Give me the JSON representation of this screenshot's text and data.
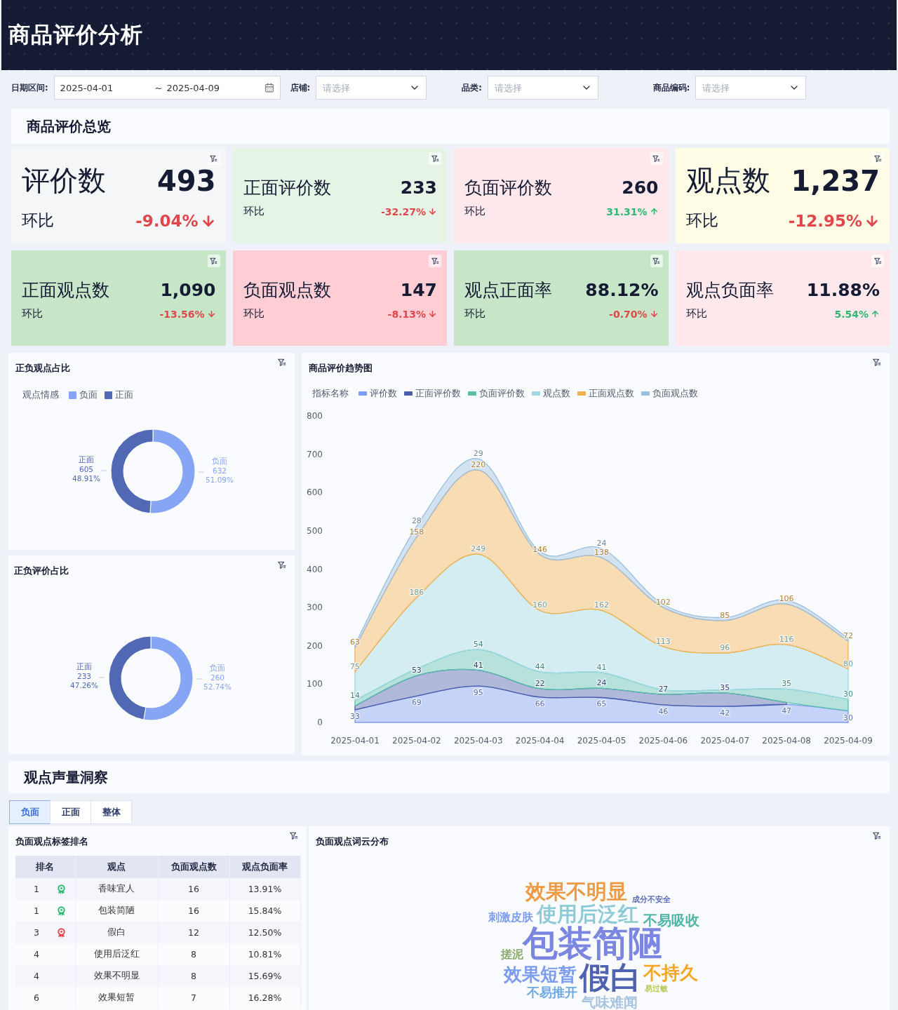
{
  "header": {
    "title": "商品评价分析"
  },
  "filters": {
    "date": {
      "label": "日期区间:",
      "start": "2025-04-01",
      "separator": "~",
      "end": "2025-04-09"
    },
    "selects": [
      {
        "label": "店铺:",
        "placeholder": "请选择"
      },
      {
        "label": "品类:",
        "placeholder": "请选择"
      },
      {
        "label": "商品编码:",
        "placeholder": "请选择"
      }
    ]
  },
  "overview": {
    "title": "商品评价总览",
    "kpis": [
      {
        "label": "评价数",
        "value": "493",
        "compare_label": "环比",
        "change": "-9.04%",
        "rising": false,
        "color": "#f5f6f7",
        "kind": "large"
      },
      {
        "label": "正面评价数",
        "value": "233",
        "compare_label": "环比",
        "change": "-32.27%",
        "rising": false,
        "color": "#e6f4e6",
        "kind": "normal"
      },
      {
        "label": "负面评价数",
        "value": "260",
        "compare_label": "环比",
        "change": "31.31%",
        "rising": true,
        "color": "#ffe8ec",
        "kind": "normal"
      },
      {
        "label": "观点数",
        "value": "1,237",
        "compare_label": "环比",
        "change": "-12.95%",
        "rising": false,
        "color": "#fffde6",
        "kind": "large"
      },
      {
        "label": "正面观点数",
        "value": "1,090",
        "compare_label": "环比",
        "change": "-13.56%",
        "rising": false,
        "color": "#c6e6c7",
        "kind": "normal"
      },
      {
        "label": "负面观点数",
        "value": "147",
        "compare_label": "环比",
        "change": "-8.13%",
        "rising": false,
        "color": "#ffcdd4",
        "kind": "normal"
      },
      {
        "label": "观点正面率",
        "value": "88.12%",
        "compare_label": "环比",
        "change": "-0.70%",
        "rising": false,
        "color": "#c6e6c7",
        "kind": "normal"
      },
      {
        "label": "观点负面率",
        "value": "11.88%",
        "compare_label": "环比",
        "change": "5.54%",
        "rising": true,
        "color": "#ffe8ec",
        "kind": "normal"
      }
    ]
  },
  "opinion_share": {
    "chart_data": {
      "type": "donut",
      "title": "正负观点占比",
      "legend_title": "观点情感",
      "categories": [
        "负面",
        "正面"
      ],
      "colors": [
        "#86a6f5",
        "#5168b4"
      ],
      "values": [
        51.09,
        48.91
      ],
      "value_labels": [
        "51.09%",
        "48.91%"
      ],
      "annotations": [
        {
          "text": "632"
        },
        {
          "text": "605"
        }
      ]
    }
  },
  "review_share": {
    "chart_data": {
      "type": "donut",
      "title": "正负评价占比",
      "categories": [
        "负面",
        "正面"
      ],
      "colors": [
        "#86a6f5",
        "#5168b4"
      ],
      "values": [
        52.74,
        47.26
      ],
      "value_labels": [
        "52.74%",
        "47.26%"
      ],
      "annotations": [
        {
          "text": "260"
        },
        {
          "text": "233"
        }
      ]
    }
  },
  "trend": {
    "chart_data": {
      "type": "area",
      "title": "商品评价趋势图",
      "legend_title": "指标名称",
      "stacked": true,
      "x": [
        "2025-04-01",
        "2025-04-02",
        "2025-04-03",
        "2025-04-04",
        "2025-04-05",
        "2025-04-06",
        "2025-04-07",
        "2025-04-08",
        "2025-04-09"
      ],
      "ylim": [
        0,
        800
      ],
      "yticks": [
        0,
        100,
        200,
        300,
        400,
        500,
        600,
        700,
        800
      ],
      "series": [
        {
          "name": "评价数",
          "color": "#7e9cf2",
          "values": [
            33,
            69,
            95,
            66,
            65,
            46,
            42,
            47,
            30
          ]
        },
        {
          "name": "正面评价数",
          "color": "#4a5ea8",
          "values": [
            10,
            53,
            41,
            22,
            24,
            27,
            35,
            5,
            null
          ]
        },
        {
          "name": "负面评价数",
          "color": "#5bbfae",
          "values": [
            14,
            18,
            54,
            44,
            41,
            12,
            8,
            35,
            30
          ]
        },
        {
          "name": "观点数",
          "color": "#9fd8e2",
          "values": [
            75,
            186,
            249,
            160,
            162,
            113,
            96,
            116,
            80
          ]
        },
        {
          "name": "正面观点数",
          "color": "#f5b14e",
          "values": [
            63,
            158,
            220,
            146,
            138,
            102,
            85,
            106,
            72
          ]
        },
        {
          "name": "负面观点数",
          "color": "#9bbfe0",
          "values": [
            8,
            28,
            29,
            8,
            24,
            8,
            8,
            10,
            8
          ]
        }
      ],
      "value_labels": [
        [
          "33",
          "69",
          "95",
          "66",
          "65",
          "46",
          "42",
          "47",
          "30"
        ],
        [
          null,
          "53",
          "41",
          "22",
          "24",
          "27",
          "35",
          null,
          null
        ],
        [
          "14",
          null,
          "54",
          "44",
          "41",
          null,
          null,
          "35",
          "30"
        ],
        [
          "75",
          "186",
          "249",
          "160",
          "162",
          "113",
          "96",
          "116",
          "80"
        ],
        [
          "63",
          "158",
          "220",
          "146",
          "138",
          "102",
          "85",
          "106",
          "72"
        ],
        [
          null,
          "28",
          "29",
          null,
          "24",
          null,
          null,
          null,
          null
        ]
      ]
    }
  },
  "insight": {
    "title": "观点声量洞察",
    "tabs": [
      {
        "label": "负面",
        "selected": true
      },
      {
        "label": "正面",
        "selected": false
      },
      {
        "label": "整体",
        "selected": false
      }
    ],
    "ranking": {
      "title": "负面观点标签排名",
      "columns": [
        "排名",
        "观点",
        "负面观点数",
        "观点负面率"
      ],
      "rows": [
        {
          "rank": "1",
          "color": "#2eb872",
          "opinion": "香味宜人",
          "count": "16",
          "rate": "13.91%"
        },
        {
          "rank": "1",
          "color": "#2eb872",
          "opinion": "包装简陋",
          "count": "16",
          "rate": "15.84%"
        },
        {
          "rank": "3",
          "color": "#e0474c",
          "opinion": "假白",
          "count": "12",
          "rate": "12.50%"
        },
        {
          "rank": "4",
          "opinion": "使用后泛红",
          "count": "8",
          "rate": "10.81%"
        },
        {
          "rank": "4",
          "opinion": "效果不明显",
          "count": "8",
          "rate": "15.69%"
        },
        {
          "rank": "6",
          "opinion": "效果短暂",
          "count": "7",
          "rate": "16.28%"
        }
      ]
    },
    "word_cloud": {
      "title": "负面观点词云分布",
      "words": [
        {
          "text": "效果不明显",
          "color": "#ee9a45",
          "kind": "l"
        },
        {
          "text": "成分不安全",
          "color": "#5b6fc0",
          "kind": "xs"
        },
        {
          "text": "刺激皮肤",
          "color": "#7b9cf0",
          "kind": "s"
        },
        {
          "text": "使用后泛红",
          "color": "#8ccbd6",
          "kind": "l"
        },
        {
          "text": "不易吸收",
          "color": "#4fb5a6",
          "kind": "m"
        },
        {
          "text": "搓泥",
          "color": "#8aa86b",
          "kind": "s"
        },
        {
          "text": "包装简陋",
          "color": "#7b86e0",
          "kind": "xl"
        },
        {
          "text": "效果短暂",
          "color": "#7b9cf0",
          "kind": "ml"
        },
        {
          "text": "假白",
          "color": "#4f63b0",
          "kind": "xl2"
        },
        {
          "text": "不持久",
          "color": "#f5a623",
          "kind": "ml"
        },
        {
          "text": "不易推开",
          "color": "#6ea8e8",
          "kind": "s2"
        },
        {
          "text": "气味难闻",
          "color": "#a6c4e0",
          "kind": "m"
        },
        {
          "text": "易过敏",
          "color": "#b5c95a",
          "kind": "xs"
        }
      ]
    }
  }
}
